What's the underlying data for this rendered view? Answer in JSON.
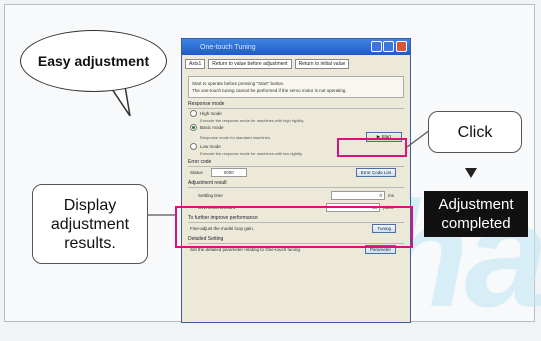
{
  "bubble": {
    "text": "Easy adjustment"
  },
  "callouts": {
    "click": "Click",
    "display_line1": "Display",
    "display_line2": "adjustment",
    "display_line3": "results.",
    "completed_line1": "Adjustment",
    "completed_line2": "completed"
  },
  "window": {
    "title": "One-touch Tuning",
    "toolbar": {
      "axis": "Axis1",
      "return_before": "Return to value before adjustment",
      "return_initial": "Return to initial value"
    },
    "message_line1": "Start to operate before pressing \"Start\" button.",
    "message_line2": "The one-touch tuning cannot be performed if the servo motor is not operating.",
    "response_mode": {
      "header": "Response mode",
      "options": [
        {
          "label": "High mode",
          "desc": "Execute the response mode for machines with high rigidity."
        },
        {
          "label": "Basic mode",
          "desc": "Response mode for standard machines."
        },
        {
          "label": "Low mode",
          "desc": "Execute the response mode for machines with low rigidity."
        }
      ],
      "start_button": "Start"
    },
    "error_code": {
      "header": "Error code",
      "status_label": "Status",
      "status_value": "0000",
      "error_list_button": "Error Code List"
    },
    "adjustment_result": {
      "header": "Adjustment result",
      "settling_label": "Settling time",
      "settling_value": "0",
      "settling_unit": "ms",
      "overshoot_label": "Overshoot amount",
      "overshoot_value": "30",
      "overshoot_unit": "pulse"
    },
    "further": {
      "header": "To further improve performance",
      "desc": "Fine-adjust the model loop gain.",
      "button": "Tuning"
    },
    "detailed": {
      "header": "Detailed Setting",
      "desc": "Set the detailed parameter relating to One-touch tuning.",
      "button": "Parameter"
    }
  },
  "watermark": "tha"
}
